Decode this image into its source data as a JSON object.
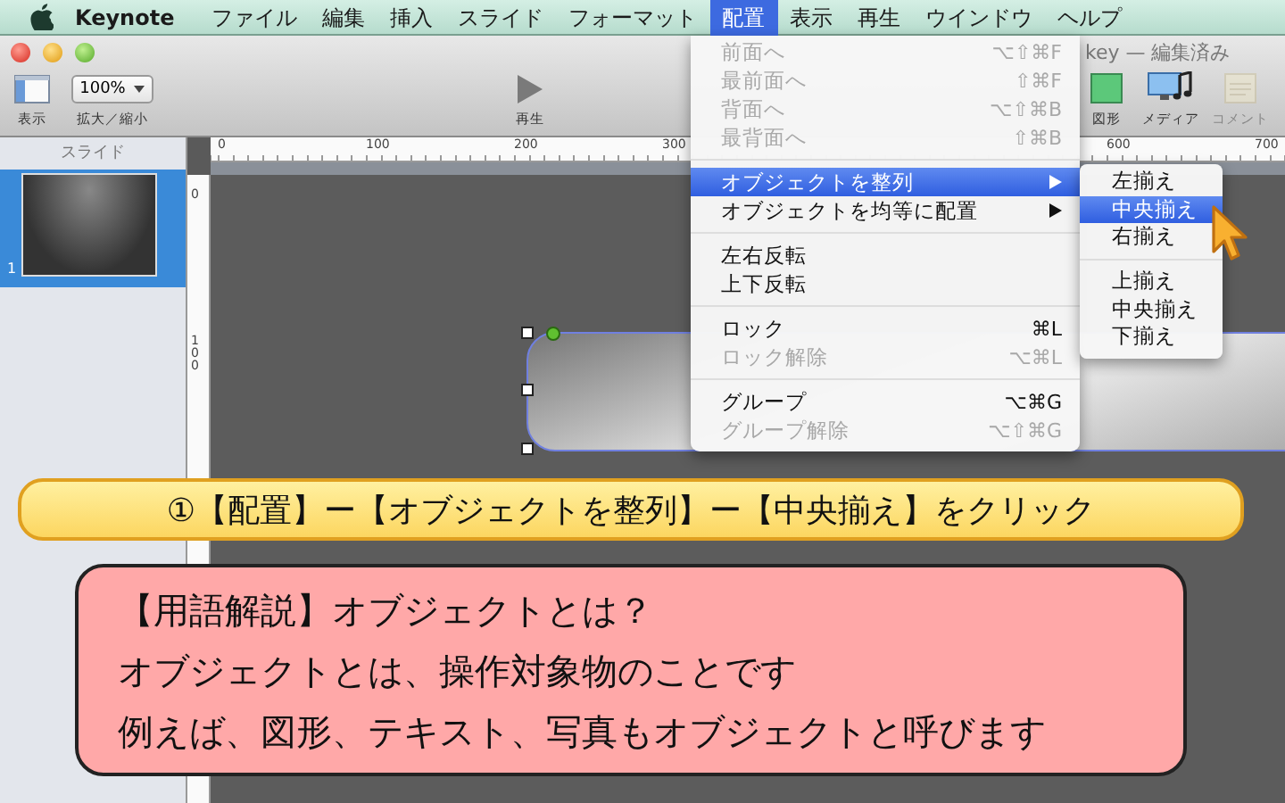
{
  "menubar": {
    "app_name": "Keynote",
    "items": [
      {
        "label": "ファイル",
        "selected": false
      },
      {
        "label": "編集",
        "selected": false
      },
      {
        "label": "挿入",
        "selected": false
      },
      {
        "label": "スライド",
        "selected": false
      },
      {
        "label": "フォーマット",
        "selected": false
      },
      {
        "label": "配置",
        "selected": true
      },
      {
        "label": "表示",
        "selected": false
      },
      {
        "label": "再生",
        "selected": false
      },
      {
        "label": "ウインドウ",
        "selected": false
      },
      {
        "label": "ヘルプ",
        "selected": false
      }
    ]
  },
  "window": {
    "title": "key — 編集済み"
  },
  "toolbar": {
    "items": [
      {
        "kind": "view",
        "label": "表示",
        "disabled": false
      },
      {
        "kind": "zoom",
        "label": "拡大／縮小",
        "value": "100%",
        "disabled": false
      },
      {
        "kind": "play",
        "label": "再生",
        "disabled": false
      },
      {
        "kind": "shape",
        "label": "図形",
        "disabled": false
      },
      {
        "kind": "media",
        "label": "メディア",
        "disabled": false
      },
      {
        "kind": "comment",
        "label": "コメント",
        "disabled": true
      }
    ]
  },
  "sidebar": {
    "heading": "スライド",
    "slides": [
      {
        "number": "1",
        "selected": true
      }
    ]
  },
  "rulers": {
    "horizontal": [
      "0",
      "100",
      "200",
      "300",
      "600",
      "700"
    ],
    "vertical": [
      "0",
      "100"
    ]
  },
  "menu": {
    "items": [
      {
        "kind": "item",
        "label": "前面へ",
        "shortcut": "⌥⇧⌘F",
        "disabled": true,
        "selected": false,
        "submenu": false
      },
      {
        "kind": "item",
        "label": "最前面へ",
        "shortcut": "⇧⌘F",
        "disabled": true,
        "selected": false,
        "submenu": false
      },
      {
        "kind": "item",
        "label": "背面へ",
        "shortcut": "⌥⇧⌘B",
        "disabled": true,
        "selected": false,
        "submenu": false
      },
      {
        "kind": "item",
        "label": "最背面へ",
        "shortcut": "⇧⌘B",
        "disabled": true,
        "selected": false,
        "submenu": false
      },
      {
        "kind": "separator"
      },
      {
        "kind": "item",
        "label": "オブジェクトを整列",
        "disabled": false,
        "selected": true,
        "submenu": true
      },
      {
        "kind": "item",
        "label": "オブジェクトを均等に配置",
        "disabled": false,
        "selected": false,
        "submenu": true
      },
      {
        "kind": "separator"
      },
      {
        "kind": "item",
        "label": "左右反転",
        "disabled": false,
        "selected": false,
        "submenu": false
      },
      {
        "kind": "item",
        "label": "上下反転",
        "disabled": false,
        "selected": false,
        "submenu": false
      },
      {
        "kind": "separator"
      },
      {
        "kind": "item",
        "label": "ロック",
        "shortcut": "⌘L",
        "disabled": false,
        "selected": false,
        "submenu": false
      },
      {
        "kind": "item",
        "label": "ロック解除",
        "shortcut": "⌥⌘L",
        "disabled": true,
        "selected": false,
        "submenu": false
      },
      {
        "kind": "separator"
      },
      {
        "kind": "item",
        "label": "グループ",
        "shortcut": "⌥⌘G",
        "disabled": false,
        "selected": false,
        "submenu": false
      },
      {
        "kind": "item",
        "label": "グループ解除",
        "shortcut": "⌥⇧⌘G",
        "disabled": true,
        "selected": false,
        "submenu": false
      }
    ]
  },
  "submenu": {
    "items": [
      {
        "kind": "item",
        "label": "左揃え",
        "selected": false
      },
      {
        "kind": "item",
        "label": "中央揃え",
        "selected": true
      },
      {
        "kind": "item",
        "label": "右揃え",
        "selected": false
      },
      {
        "kind": "separator"
      },
      {
        "kind": "item",
        "label": "上揃え",
        "selected": false
      },
      {
        "kind": "item",
        "label": "中央揃え",
        "selected": false
      },
      {
        "kind": "item",
        "label": "下揃え",
        "selected": false
      }
    ]
  },
  "instruction": {
    "text": "①【配置】ー【オブジェクトを整列】ー【中央揃え】をクリック"
  },
  "note": {
    "lines": [
      "【用語解説】オブジェクトとは？",
      "オブジェクトとは、操作対象物のことです",
      "例えば、図形、テキスト、写真もオブジェクトと呼びます"
    ]
  }
}
